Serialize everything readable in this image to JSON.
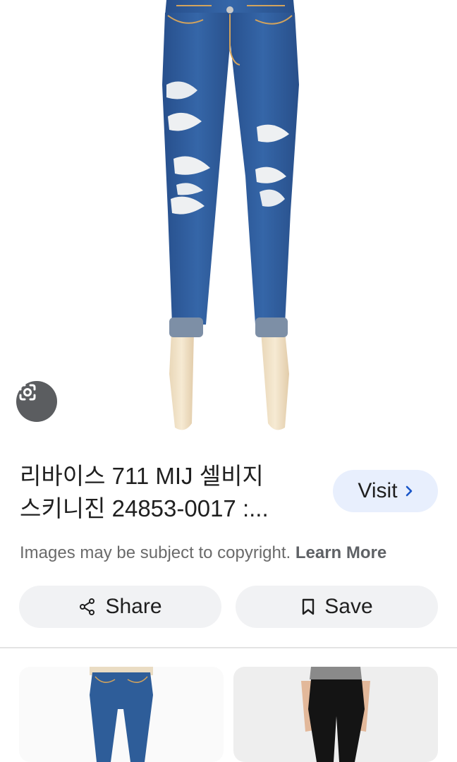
{
  "result": {
    "title_line1": "리바이스 711 MIJ 셀비지",
    "title_line2": "스키니진 24853-0017 :...",
    "visit_label": "Visit",
    "copyright_text": "Images may be subject to copyright.",
    "learn_more_label": "Learn More"
  },
  "actions": {
    "share_label": "Share",
    "save_label": "Save"
  },
  "icons": {
    "lens": "google-lens-icon",
    "share": "share-icon",
    "save": "bookmark-icon",
    "visit": "chevron-right-icon"
  },
  "colors": {
    "visit_bg": "#e8effd",
    "accent": "#1a56c8",
    "button_bg": "#f1f2f4",
    "denim": "#2f5fa0"
  }
}
